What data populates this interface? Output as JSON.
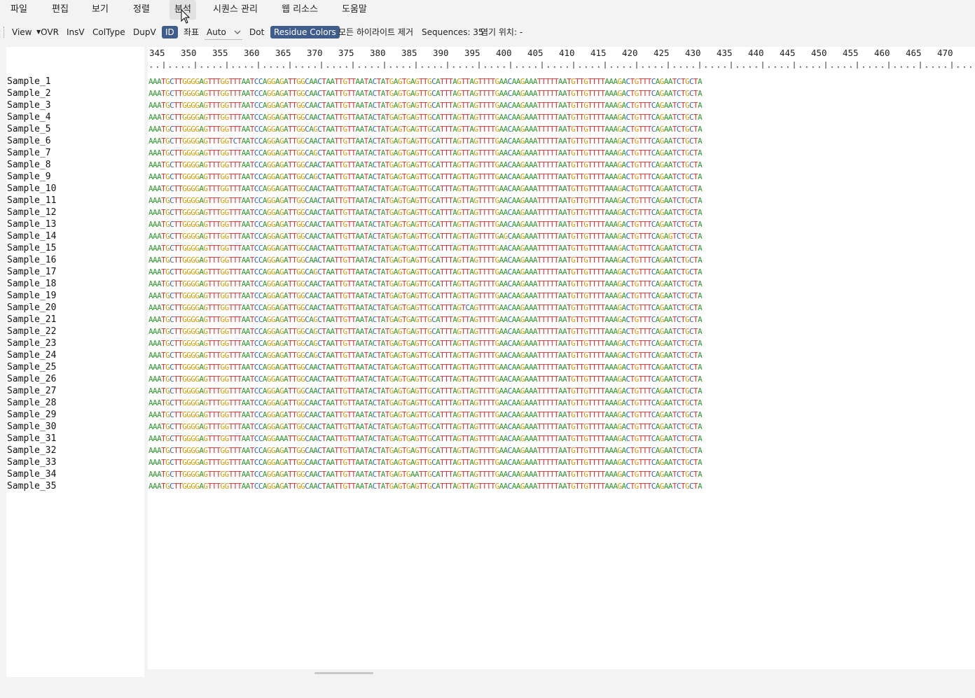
{
  "menu": {
    "items": [
      "파일",
      "편집",
      "보기",
      "정렬",
      "분석",
      "시퀀스 관리",
      "웹 리소스",
      "도움말"
    ],
    "active_index": 4
  },
  "toolbar": {
    "view_label": "View",
    "ovr_label": "OVR",
    "insv_label": "InsV",
    "coltype_label": "ColType",
    "dupv_label": "DupV",
    "id_label": "ID",
    "coord_label": "좌표",
    "coord_select_value": "Auto",
    "dot_label": "Dot",
    "residue_colors_label": "Residue Colors",
    "clear_highlights_label": "모든 하이라이트 제거",
    "sequences_label": "Sequences: 35",
    "frame_label": "염기 위치: -"
  },
  "ruler": {
    "ticks": [
      "345",
      "350",
      "355",
      "360",
      "365",
      "370",
      "375",
      "380",
      "385",
      "390",
      "395",
      "400",
      "405",
      "410",
      "415",
      "420",
      "425",
      "430",
      "435",
      "440",
      "445",
      "450",
      "455",
      "460",
      "465",
      "470"
    ]
  },
  "alignment": {
    "rows": [
      {
        "name": "Sample_1",
        "seq": "AAATGCTTGGGGAGTTTGGTTTAATCCAGGAGATTGGCAACTAATTGTTAATACTATGAGTGAGTTGCATTTAGTTAGTTTTGAACAAGAAATTTTTAATGTTGTTTTAAAGACTGTTTCAGAATCTGCTA"
      },
      {
        "name": "Sample_2",
        "seq": "AAATGCTTGGGGAGTTTGGTTTAATCCAGGAGATTGGCAACTAATTGTTAATACTATGAGTGAGTTGCATTTAGTTAGTTTTGAACAAGAAATTTTTAATGTTGTTTTAAAGACTGTTTCAGAATCTGCTA"
      },
      {
        "name": "Sample_3",
        "seq": "AAATGCTTGGGGAGTTTGGTTTAATCCAGGAGATTGGCAACTAATTGTTAATACTATGAGTGAGTTGCATTTAGTTAGTTTTGAACAAGAAATTTTTAATGTTGTTTTAAAGACTGTTTCAGAATCTGCTA"
      },
      {
        "name": "Sample_4",
        "seq": "AAATGCTTGGGGAGTTTGGTTTAATCCAGGAGATTGGCAACTAATTGTTAATACTATGAGTGAGTTGCATTTAGTTAGTTTTGAACAAGAAATTTTTAATGTTGTTTTAAAGACTGTTTCAGAATCTGCTA"
      },
      {
        "name": "Sample_5",
        "seq": "AAATGCTTGGGGAGTTTGGTTTAATCCAGGAGATTGGCAGCTAATTGTTAATACTATGAGTGAGTTGCATTTAGTTAGTTTTGAACAAGAAATTTTTAATGTTGTTTTAAAGACTGTTTCAGAATCTGCTA"
      },
      {
        "name": "Sample_6",
        "seq": "AAATGCTTGGGGAGTTTGGTCTAATCCAGGAGATTGGCAACTAATTGTTAATACTATGAGTGAGTTGCATTTAGTTAGTTTTGAACAAGAAATTTTTAATGTTGTTTTAAAGACTGTTTCAGAATCTGCTA"
      },
      {
        "name": "Sample_7",
        "seq": "AAATGCTTGGGGAGTTTGGTTTAATCCAGGAGATTGGCAGCTAATTGTTAATACTATGAGTGAGTTGCATTTAGTTAGTTTTGAACAAGAAATTTTTAATGTTGTTTTAAAGACTGTTTCAGAATCTGCTA"
      },
      {
        "name": "Sample_8",
        "seq": "AAATGCTTGGGGAGTTTGGTTTAATCCAGGAGATTGGCAACTAATTGTTAATACTATGAGTGAGTTGCATTTAGTTAGTTTTGAACAAGAAATTTTTAATGTTGTTTTAAAGACTGTTTCAGAATCTGCTA"
      },
      {
        "name": "Sample_9",
        "seq": "AAATGCTTGGGGAGTTTGGTTTAATCCAGGAGATTGGCAGCTAATTGTTAATACTATGAGTGAGTTGCATTTAGTTAGTTTTGAACAAGAAATTTTTAATGTTGTTTTAAAGACTGTTTCAGAATCTGCTA"
      },
      {
        "name": "Sample_10",
        "seq": "AAATGCTTGGGGAGTTTGGTTTAATCCAGGAGATTGGCAACTAATTGTTAATACTATGAGTGAGTTGCATTTAGTTAGTTTTGAACAAGAAATTTTTAATGTTGTTTTAAAGACTGTTTCAGAATCTGCTA"
      },
      {
        "name": "Sample_11",
        "seq": "AAATGCTTGGGGAGTTTGGTTTAATCCAGGAGATTGGCAACTAATTGTTAATACTATGAGTGAGTTGCATTTAGTTAGTTTTGAACAAGAAATTTTTAATGTTGTTTTAAAGACTGTTTCAGAATCTGCTA"
      },
      {
        "name": "Sample_12",
        "seq": "AAATGCTTGGGGAGTTTGGTTTAATCCAGGAGATTGGCAACTAATTGTTAATACTATGAGTGAGTTGCATTTAGTTAGTTTTGAACAAGAAATTTTTAATGTTGTTTTAAAGACTGTTTCAGAATCTGCTA"
      },
      {
        "name": "Sample_13",
        "seq": "AAATGCTTGGGGAGTTTGGTTTAATCCAGGAGATTGGCAACTAATTGTTAATACTATGAGTGAGTTGCATTTAGTTAGTTTTGAACAAGAAATTTTTAATGTTGTTTTAAAGACTGTTTCAGAATCTGCTA"
      },
      {
        "name": "Sample_14",
        "seq": "AAATGCTTGGGGAGTTTGGTTTAATCCAGGAGATTGGCAACTAATTGTTAATACTATGAGTGAGTTGCATTTAGTTAGTTTTGAGCAAGAAATTTTTAATGTTGTTTTAAAGACTGTTTCAGAGTCTGCTA"
      },
      {
        "name": "Sample_15",
        "seq": "AAATGCTTGGGGAGTTTGGTTTAATCCAGGAGATTGGCAACTAATTGTTAATACTATGAGTGAGTTGCATTTAGTTAGTTTTGAACAAGAAATTTTTAATGTTGTTTTAAAGACTGTTTCAGAATCTGCTA"
      },
      {
        "name": "Sample_16",
        "seq": "AAATGCTTGGGGAGTTTGGTTTAATCCAGGAGATTGGCAACTAATTGTTAATACTATGAGTGAGTTGCATTTAGTTAGTTTTGAACAAGAAATTTTTAATGTTGTTTTAAAGACTGTTTCAGAATCTGCTA"
      },
      {
        "name": "Sample_17",
        "seq": "AAATGCTTGGGGAGTTTGGTTTAATCCAGGAGATTGGCAGCTAATTGTTAATACTATGAGTGAGTTGCATTTAGTTAGTTTTGAACAAGAAATTTTTAATGTTGTTTTAAAGACTGTTTCAGAATCTGCTA"
      },
      {
        "name": "Sample_18",
        "seq": "AAATGCTTGGGGAGTTTGGTTTAATCCAGGAGATTGGCAACTAATTGTTAATACTATGAGTGAGTTGCATTTAGTTAGTTTTGAACAAGAAATTTTTAATGTTGTTTTAAAGACTGTTTCAGAATCTGCTA"
      },
      {
        "name": "Sample_19",
        "seq": "AAATGCTTGGGGAGTTTGGTTTAATCCAGGAGATTGGCAACTAATTGTTAATACTATGAGTGAGTTGCATTTAGTTAGTTTTGAACAAGAAATTTTTAATGTTGTTTTAAAGACTGTTTCAGAATCTGCTA"
      },
      {
        "name": "Sample_20",
        "seq": "AAATGCTTGGGGAGTTTGGTTTAATCCAGGAGATTGGCAACTAATTGTTAATACTATGAGTGAGTTGCATTTAGTCAGTTTTGAACAAGAAATTTTTAATGTTGTTTTAAAGACTGTTTCAGAATCTGCTA"
      },
      {
        "name": "Sample_21",
        "seq": "AAATGCTTGGGGAGTTTGGTTTAATCCAGGAGATTGGCAGCTAATTGTTAATACTATGAGTGAGTTGCATTTAGTTAGTTTTGAACAAGAAATTTTTAATGTTGTTTTAAAGACTGTTTCAGAATCTGCTA"
      },
      {
        "name": "Sample_22",
        "seq": "AAATGCTTGGGGAGTTTGGTTTAATCCAGGAGATTGGCAGCTAATTGTTAATACTATGAGTGAGTTGCATTTAGTTAGTTTTGAACAAGAAATTTTTAATGTTGTTTTAAAGACTGTTTCAGAATCTGCTA"
      },
      {
        "name": "Sample_23",
        "seq": "AAATGCTTGGGGAGTTTGGTTTAATCCAGGAGATTGGCAGCTAATTGTTAATACTATGAGTGAGTTGCATTTAGTTAGTTTTGAACAAGAAATTTTTAATGTTGTTTTAAAGACTGTTTCAGAATCTGCTA"
      },
      {
        "name": "Sample_24",
        "seq": "AAATGCTTGGGGAGTTTGGTTTAATCCAGGAGATTGGCAGCTAATTGTTAATACTATGAGTGAGTTGCATTTAGTTAGTTTTGAACAAGAAATTTTTAATGTTGTTTTAAAGACTGTTTCAGAATCTGCTA"
      },
      {
        "name": "Sample_25",
        "seq": "AAATGCTTGGGGAGTTTGGTTTAATCCAGGAGATTGGCAACTAATTGTTAATACTATGAGTGAGTTGCATTTAGTTAGTTTTGAACAAGAAATTTTTAATGTTGTTTTAAAGACTGTTTCAGAATCTGCTA"
      },
      {
        "name": "Sample_26",
        "seq": "AAATGCTTGGGGAGTTTGGTTTAATCCAGGAGATTGGCAACTAATTGTTAATACTATGAGTGAGTTGCATTTAGTTAGTTTTGAACAAGAAATTTTTAATGTTGTTTTAAAGACTGTTTCAGAATCTGCTA"
      },
      {
        "name": "Sample_27",
        "seq": "AAATGCTTGGGGAGTTTGGTTTAATCCAGGAGATTGGCAACTAATTGTTAATACTATGAGTGAGTTGCATTTAGTTAGTTTTGAACAAGAAATTTTTAATGTTGTTTTAAAGACTGTTTCAGAATCTGCTA"
      },
      {
        "name": "Sample_28",
        "seq": "AAATGCTTGGGGAGTTTGGTTTAATCCAGGAGATTGGCAACTAATTGTTAATACTATGAGTGAGTTGCATTTAGTTAGTTTTGAACAAGAAATTTTTAATGTTGTTTTAAAGACTGTTTCAGAATCTGCTA"
      },
      {
        "name": "Sample_29",
        "seq": "AAATGCTTGGGGAGTTTGGTTTAATCCAGGAGATTGGCAACTAATTGTTAATACTATGAGTGAGTTGCATTTAGTTAGTTTTGAACAAGAAATTTTTAATGTTGTTTTAAAGACTGTTTCAGAATCTGCTA"
      },
      {
        "name": "Sample_30",
        "seq": "AAATGCTTGGGGAGTTTGGTTTAATCCAGGAGATTGGCAACTAATTGTTAATACTATGAGTGAGTTGCATTTAGTTAGTTTTGAACAAGAAATTTTTAATGTTGTTTTAAAGACTGTTTCAGAATCTGCTA"
      },
      {
        "name": "Sample_31",
        "seq": "AAATGCTTGGGGAGTTTGGTTTAATCCAGGAAATTGGCAACTAATTGTTAATACTATGAGTGAGTTGCATTTAGTTAGTTTTGAACAAGAAATTTTTAATGTTGTTTTAAAGACTGTTTCAGAATCTGCTA"
      },
      {
        "name": "Sample_32",
        "seq": "AAATGCTTGGGGAGTTTGGTTTAATCCAGGAGATTGGCAACTAATTGTTAATACTATGAGTGAGTTGCATTTAGTTAGTTTTGAACAAGAAATTTTTAATGTTGTTTTAAAGACTGTTTCAGAATCTGCTA"
      },
      {
        "name": "Sample_33",
        "seq": "AAATGCTTGGGGAGTTTGGTTTAATCCAGGAGATTGGCAACTAATTGTTAATACTATGAGTGAGTTGCATTTAGTTAGTTTTGAACAAGAAATTTTTAATGTTGTTTTAAAGACTGTTTCAGAATCTGCTA"
      },
      {
        "name": "Sample_34",
        "seq": "AAATGCTTGGGGAGTTTGGTTTAATCCAGGAGATTGGCAACTAATTGTTAATACTATGAGTGAATTGCATTTAGTTAGTTTTGAACAAGAAATTTTTAATGTTGTTTTAAAGACTGTTTCAGAATCTGCTA"
      },
      {
        "name": "Sample_35",
        "seq": "AAATGCTTGGGGAGTTTGGTTTAATCCAGGAGATTGGCAACTAATTGTTAATACTATGAGTGAGTTGCATTTAGTTAGTTTTGAACAAGAAATTTTTAATGTTGTTTTAAAGACTGTTTCAGAATCTGCTA"
      }
    ]
  },
  "colors": {
    "A": "#2f9a2f",
    "C": "#2b63b8",
    "G": "#d19a00",
    "T": "#d43030",
    "accent_button": "#3f5d8c"
  },
  "icons": {
    "view_dropdown": "caret-down-icon",
    "select_dropdown": "chevron-down-icon",
    "cursor": "mouse-pointer-icon"
  }
}
